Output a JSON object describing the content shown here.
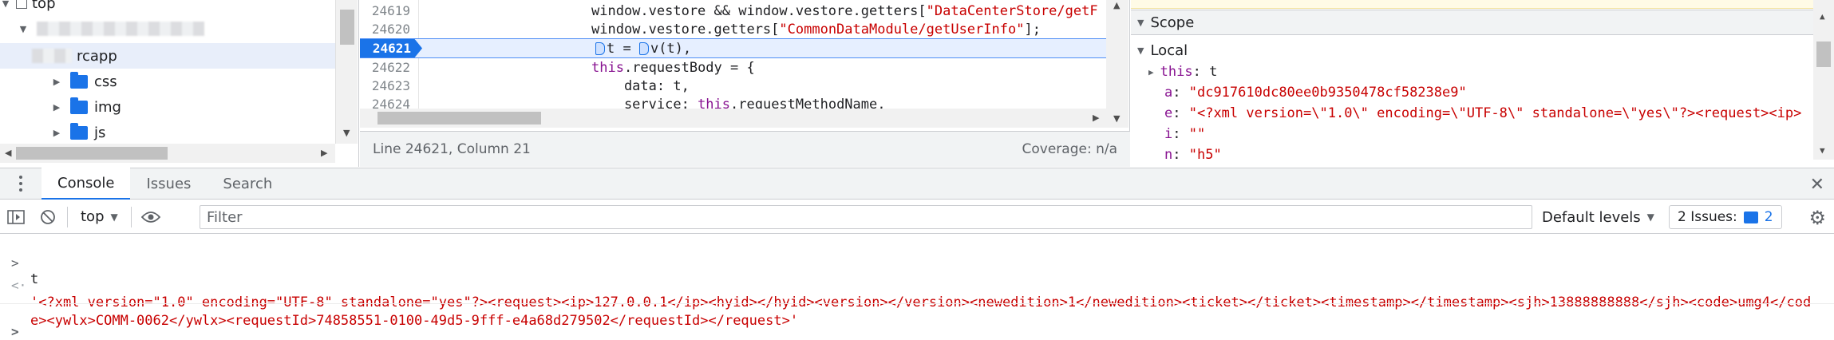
{
  "tree": {
    "top_item_label": "top",
    "app_folder_label": "rcapp",
    "folders": [
      {
        "label": "css"
      },
      {
        "label": "img"
      },
      {
        "label": "js"
      }
    ]
  },
  "editor": {
    "lines": [
      {
        "num": "24619",
        "segments": [
          {
            "t": "window.vestore && window.vestore.getters[",
            "c": ""
          },
          {
            "t": "\"DataCenterStore/getF",
            "c": "str"
          }
        ]
      },
      {
        "num": "24620",
        "segments": [
          {
            "t": "window.vestore.getters[",
            "c": ""
          },
          {
            "t": "\"CommonDataModule/getUserInfo\"",
            "c": "str"
          },
          {
            "t": "];",
            "c": ""
          }
        ]
      },
      {
        "num": "24621",
        "segments": [
          {
            "t": "t = ",
            "c": ""
          },
          {
            "t": "v(t),",
            "c": ""
          }
        ]
      },
      {
        "num": "24622",
        "segments": [
          {
            "t": "this",
            "c": "kw"
          },
          {
            "t": ".requestBody = {",
            "c": ""
          }
        ]
      },
      {
        "num": "24623",
        "segments": [
          {
            "t": "    data: t,",
            "c": ""
          }
        ]
      },
      {
        "num": "24624",
        "segments": [
          {
            "t": "    service: ",
            "c": ""
          },
          {
            "t": "this",
            "c": "kw"
          },
          {
            "t": ".requestMethodName,",
            "c": ""
          }
        ]
      }
    ],
    "paused_line": "24621",
    "status_position": "Line 24621, Column 21",
    "coverage": "Coverage: n/a"
  },
  "scope": {
    "header": "Scope",
    "local_label": "Local",
    "this_row": {
      "name": "this",
      "value": "t"
    },
    "vars": [
      {
        "name": "a",
        "value": "\"dc917610dc80ee0b9350478cf58238e9\""
      },
      {
        "name": "e",
        "value": "\"<?xml version=\\\"1.0\\\" encoding=\\\"UTF-8\\\" standalone=\\\"yes\\\"?><request><ip>"
      },
      {
        "name": "i",
        "value": "\"\""
      },
      {
        "name": "n",
        "value": "\"h5\""
      }
    ]
  },
  "drawer": {
    "tabs": [
      {
        "label": "Console",
        "active": true
      },
      {
        "label": "Issues",
        "active": false
      },
      {
        "label": "Search",
        "active": false
      }
    ]
  },
  "toolbar": {
    "context": "top",
    "filter_placeholder": "Filter",
    "levels": "Default levels",
    "issues_label": "2 Issues:",
    "issues_count": "2"
  },
  "console": {
    "input_expr": "t",
    "result": "'<?xml version=\"1.0\" encoding=\"UTF-8\" standalone=\"yes\"?><request><ip>127.0.0.1</ip><hyid></hyid><version></version><newedition>1</newedition><ticket></ticket><timestamp></timestamp><sjh>13888888888</sjh><code>umg4</code><ywlx>COMM-0062</ywlx><requestId>74858551-0100-49d5-9fff-e4a68d279502</requestId></request>'"
  },
  "colors": {
    "accent": "#1a73e8",
    "string": "#c80000",
    "keyword": "#881391"
  }
}
